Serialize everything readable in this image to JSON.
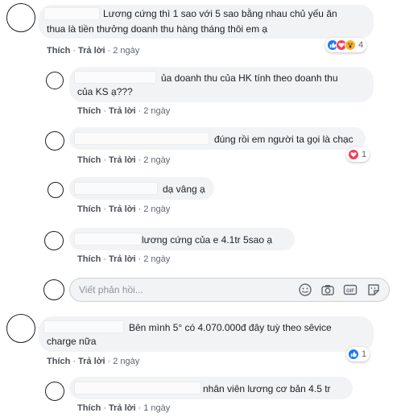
{
  "comments": [
    {
      "id": "c1",
      "text_lines": [
        "Lương cứng thì 1 sao với 5 sao bằng nhau chủ yếu ăn",
        "thua là tiền thưởng doanh thu hàng tháng thôi em ạ"
      ],
      "actions": {
        "like": "Thích",
        "reply": "Trả lời",
        "time": "2 ngày"
      },
      "reactions": {
        "types": [
          "like-icon",
          "love-icon",
          "wow-icon"
        ],
        "count": "4"
      }
    },
    {
      "id": "r1",
      "text_lines": [
        "ủa doanh thu của HK tính theo doanh thu",
        "của KS ạ???"
      ],
      "actions": {
        "like": "Thích",
        "reply": "Trả lời",
        "time": "2 ngày"
      }
    },
    {
      "id": "r2",
      "text_lines": [
        "đúng rồi em người ta gọi là chạc"
      ],
      "actions": {
        "like": "Thích",
        "reply": "Trả lời",
        "time": "2 ngày"
      },
      "reactions": {
        "types": [
          "love-icon"
        ],
        "count": "1"
      }
    },
    {
      "id": "r3",
      "text_lines": [
        "dạ vâng ạ"
      ],
      "actions": {
        "like": "Thích",
        "reply": "Trả lời",
        "time": "2 ngày"
      }
    },
    {
      "id": "r4",
      "text_lines": [
        "lương cứng của e 4.1tr 5sao ạ"
      ],
      "actions": {
        "like": "Thích",
        "reply": "Trả lời",
        "time": "2 ngày"
      }
    },
    {
      "id": "c2",
      "text_lines": [
        "Bên mình 5° có 4.070.000đ đây tuỳ theo sêvice",
        "charge nữa"
      ],
      "actions": {
        "like": "Thích",
        "reply": "Trả lời",
        "time": "2 ngày"
      },
      "reactions": {
        "types": [
          "like-icon"
        ],
        "count": "1"
      }
    },
    {
      "id": "r5",
      "text_lines": [
        "nhân viên lương cơ bản 4.5 tr"
      ],
      "actions": {
        "like": "Thích",
        "reply": "Trả lời",
        "time": "1 ngày"
      }
    }
  ],
  "reply_input": {
    "placeholder": "Viết phản hồi...",
    "tools": [
      "emoji-icon",
      "camera-icon",
      "gif-icon",
      "sticker-icon"
    ]
  },
  "colors": {
    "like": "#1877f2",
    "love": "#f33e58",
    "wow": "#f7b125",
    "bubble": "#f2f3f5",
    "meta": "#606770"
  }
}
